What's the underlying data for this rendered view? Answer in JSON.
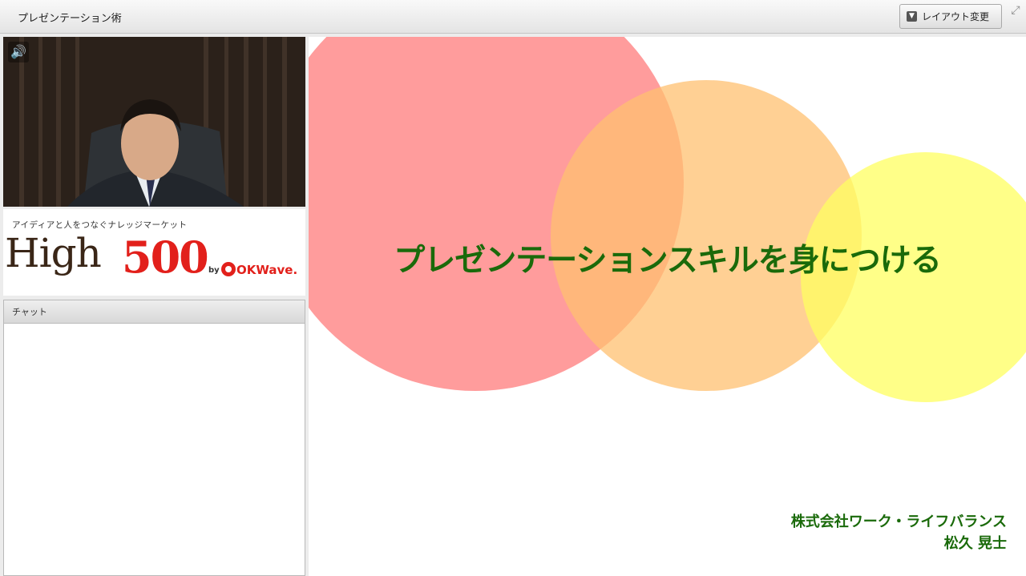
{
  "window": {
    "title": "プレゼンテーション術",
    "layout_button": "レイアウト変更"
  },
  "video": {
    "speaker_icon": "speaker-icon"
  },
  "banner": {
    "tagline": "アイディアと人をつなぐナレッジマーケット",
    "high": "High",
    "five": "500",
    "by": "by",
    "okwave": "OKWave."
  },
  "chat": {
    "header": "チャット"
  },
  "slide": {
    "title": "プレゼンテーションスキルを身につける",
    "company": "株式会社ワーク・ライフバランス",
    "presenter": "松久 晃士",
    "colors": {
      "circle_red": "#ff8080",
      "circle_orange": "#ffc87a",
      "circle_yellow": "#ffff70",
      "text_green": "#1a6a0a"
    }
  }
}
